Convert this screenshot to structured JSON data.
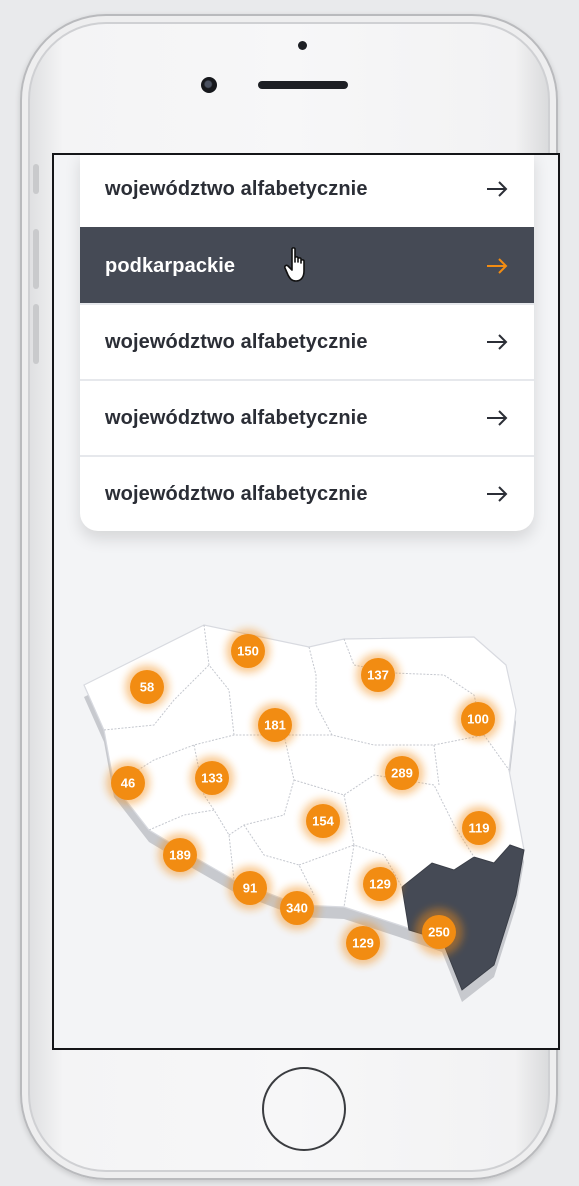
{
  "list": {
    "items": [
      {
        "label": "województwo alfabetycznie",
        "active": false
      },
      {
        "label": "podkarpackie",
        "active": true
      },
      {
        "label": "województwo alfabetycznie",
        "active": false
      },
      {
        "label": "województwo alfabetycznie",
        "active": false
      },
      {
        "label": "województwo alfabetycznie",
        "active": false
      }
    ]
  },
  "map": {
    "badges": [
      "150",
      "137",
      "58",
      "181",
      "100",
      "46",
      "133",
      "289",
      "154",
      "119",
      "189",
      "91",
      "340",
      "129",
      "129",
      "250"
    ],
    "highlighted_region": "podkarpackie"
  },
  "colors": {
    "accent": "#f28c12",
    "active_row": "#454a55",
    "text": "#2b2e36",
    "highlight_region": "#454a55"
  },
  "icons": {
    "row_arrow": "arrow-right-icon",
    "cursor": "hand-pointer-icon"
  }
}
